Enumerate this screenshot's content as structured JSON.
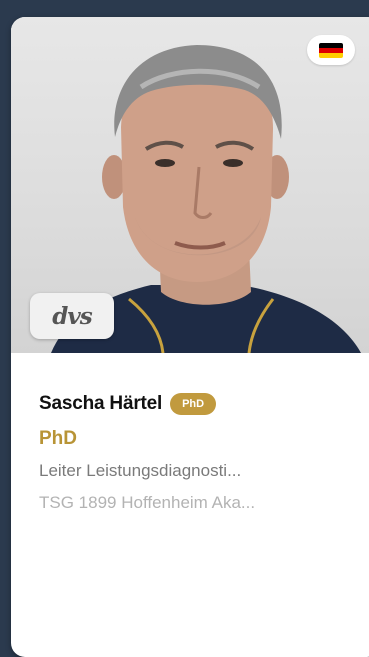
{
  "profile": {
    "name": "Sascha Härtel",
    "title_badge": "PhD",
    "degree": "PhD",
    "role": "Leiter Leistungsdiagnosti...",
    "organization": "TSG 1899 Hoffenheim Aka..."
  },
  "badges": {
    "flag_icon": "germany-flag-icon",
    "logo_text": "dvs"
  },
  "colors": {
    "background": "#2b3a4e",
    "accent_gold": "#c19a3e",
    "card": "#ffffff",
    "flag": [
      "#000000",
      "#dd0000",
      "#ffce00"
    ]
  }
}
